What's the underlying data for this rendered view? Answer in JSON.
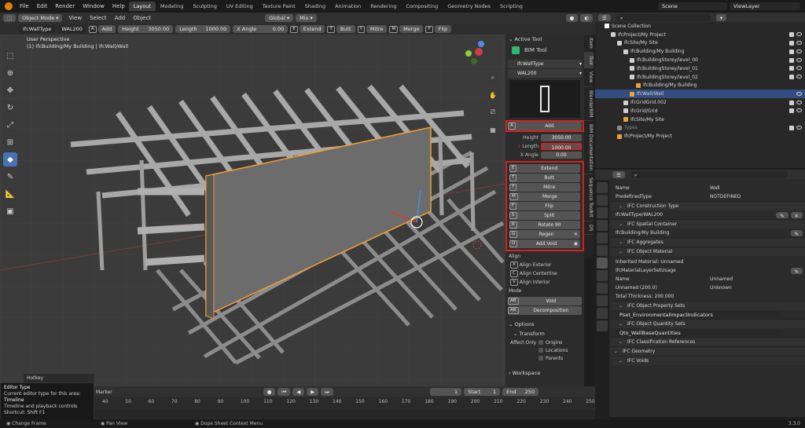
{
  "menu": [
    "File",
    "Edit",
    "Render",
    "Window",
    "Help"
  ],
  "workspaces": [
    {
      "label": "Layout",
      "active": true
    },
    {
      "label": "Modeling"
    },
    {
      "label": "Sculpting"
    },
    {
      "label": "UV Editing"
    },
    {
      "label": "Texture Paint"
    },
    {
      "label": "Shading"
    },
    {
      "label": "Animation"
    },
    {
      "label": "Rendering"
    },
    {
      "label": "Compositing"
    },
    {
      "label": "Geometry Nodes"
    },
    {
      "label": "Scripting"
    }
  ],
  "scene": {
    "label": "Scene",
    "view_layer": "ViewLayer"
  },
  "viewport_header": {
    "mode": "Object Mode",
    "menus": [
      "View",
      "Select",
      "Add",
      "Object"
    ],
    "orientation": "Global",
    "pivot": "Mix"
  },
  "tool_header": {
    "type": "IfcWallType",
    "type_value": "WAL200",
    "add_key": "A",
    "add_label": "Add",
    "height_label": "Height",
    "height_value": "3050.00",
    "length_label": "Length",
    "length_value": "1000.00",
    "xangle_label": "X Angle",
    "xangle_value": "0.00",
    "extend_key": "E",
    "extend_label": "Extend",
    "butt_key": "T",
    "butt_label": "Butt",
    "mitre_key": "Y",
    "mitre_label": "Mitre",
    "merge_key": "M",
    "merge_label": "Merge",
    "flip_key": "F",
    "flip_label": "Flip"
  },
  "viewport": {
    "perspective": "User Perspective",
    "object_path": "(1) IfcBuilding/My Building | IfcWall/Wall",
    "hotkey": "Hotkey"
  },
  "npanel": {
    "active_tool": "Active Tool",
    "tool_name": "BIM Tool",
    "class": "IfcWallType",
    "type": "WAL200",
    "add_key": "A",
    "add": "Add",
    "height_label": "Height",
    "height": "3050.00",
    "length_label": "Length",
    "length": "1000.00",
    "marker": "1",
    "xangle_label": "X Angle",
    "xangle": "0.00",
    "actions": [
      {
        "key": "E",
        "label": "Extend"
      },
      {
        "key": "T",
        "label": "Butt"
      },
      {
        "key": "Y",
        "label": "Mitre"
      },
      {
        "key": "M",
        "label": "Merge"
      },
      {
        "key": "F",
        "label": "Flip"
      },
      {
        "key": "S",
        "label": "Split"
      },
      {
        "key": "R",
        "label": "Rotate 90"
      },
      {
        "key": "G",
        "label": "Regen"
      },
      {
        "key": "O",
        "label": "Add Void"
      }
    ],
    "align_title": "Align",
    "align": [
      {
        "key": "X",
        "label": "Align Exterior"
      },
      {
        "key": "C",
        "label": "Align Centerline"
      },
      {
        "key": "V",
        "label": "Align Interior"
      }
    ],
    "mode_title": "Mode",
    "mode": [
      {
        "key": "AB",
        "label": "Void"
      },
      {
        "key": "AB",
        "label": "Decomposition"
      }
    ],
    "options": "Options",
    "transform": "Transform",
    "affect_only": "Affect Only",
    "affect": [
      "Origins",
      "Locations",
      "Parents"
    ],
    "workspace": "Workspace"
  },
  "vtabs": [
    "Item",
    "Tool",
    "View",
    "BlenderBIM",
    "BIM Documentation",
    "Sequence Toolkit",
    "DS"
  ],
  "outliner": {
    "items": [
      {
        "label": "Scene Collection",
        "indent": 0
      },
      {
        "label": "IfcProject/My Project",
        "indent": 1
      },
      {
        "label": "IfcSite/My Site",
        "indent": 2
      },
      {
        "label": "IfcBuilding/My Building",
        "indent": 3
      },
      {
        "label": "IfcBuildingStorey/level_00",
        "indent": 4
      },
      {
        "label": "IfcBuildingStorey/level_01",
        "indent": 4
      },
      {
        "label": "IfcBuildingStorey/level_02",
        "indent": 4
      },
      {
        "label": "IfcBuilding/My Building",
        "indent": 4
      },
      {
        "label": "IfcWall/Wall",
        "indent": 4,
        "selected": true
      },
      {
        "label": "IfcGridGrid.002",
        "indent": 3
      },
      {
        "label": "IfcGrid/Grid",
        "indent": 3
      },
      {
        "label": "IfcSite/My Site",
        "indent": 3
      },
      {
        "label": "Types",
        "indent": 2
      },
      {
        "label": "IfcProject/My Project",
        "indent": 2
      }
    ]
  },
  "properties": {
    "name_label": "Name",
    "name_value": "Wall",
    "predef_label": "PredefinedType",
    "predef_value": "NOTDEFINED",
    "construction_type": "IFC Construction Type",
    "wall_type": "IfcWallType/WAL200",
    "spatial_container": "IFC Spatial Container",
    "building": "IfcBuilding/My Building",
    "aggregates": "IFC Aggregates",
    "object_material": "IFC Object Material",
    "inherited": "Inherited Material: Unnamed",
    "layer_set": "IfcMaterialLayerSetUsage",
    "name2_label": "Name",
    "name2_value": "Unnamed",
    "layer": "Unnamed (200.0)",
    "unknown": "Unknown",
    "thickness": "Total Thickness: 200.000",
    "property_sets": "IFC Object Property Sets",
    "pset": "Pset_EnvironmentalImpactIndicators",
    "quantity_sets": "IFC Object Quantity Sets",
    "qto": "Qto_WallBaseQuantities",
    "class_refs": "IFC Classification References",
    "geometry": "IFC Geometry",
    "voids": "IFC Voids"
  },
  "timeline": {
    "marker": "Marker",
    "frame": "1",
    "start_label": "Start",
    "start": "1",
    "end_label": "End",
    "end": "250",
    "ticks": [
      "40",
      "50",
      "60",
      "70",
      "80",
      "90",
      "100",
      "110",
      "120",
      "130",
      "140",
      "150",
      "160",
      "170",
      "180",
      "190",
      "200",
      "210",
      "220",
      "230",
      "240",
      "250"
    ]
  },
  "tooltip": {
    "title": "Editor Type",
    "line1": "Current editor type for this area:",
    "current": "Timeline",
    "line2": "Timeline and playback controls",
    "line3": "Shortcut: Shift F1"
  },
  "status": {
    "left": "Change Frame",
    "mid": "Pan View",
    "right": "Dope Sheet Context Menu",
    "version": "3.3.0"
  },
  "colors": {
    "accent": "#4772b3",
    "highlight": "#d71f1f",
    "selection_outline": "#f0a030"
  }
}
